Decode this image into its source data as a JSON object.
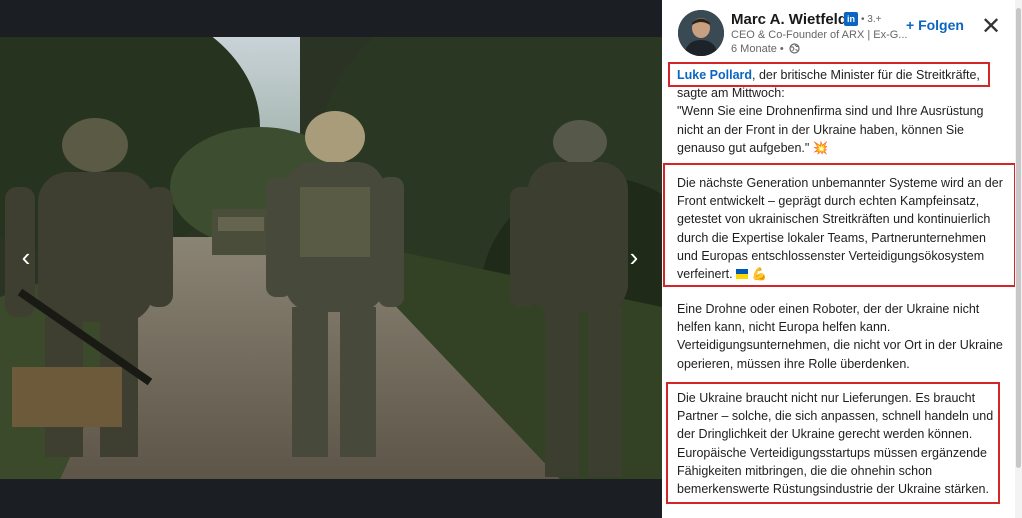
{
  "navigation": {
    "prev_label": "‹",
    "next_label": "›"
  },
  "author": {
    "name": "Marc A. Wietfeld",
    "badge": "in",
    "degree": "• 3.+",
    "headline": "CEO & Co-Founder of ARX | Ex-G...",
    "time": "6 Monate •",
    "visibility_icon": "globe-icon"
  },
  "actions": {
    "follow_label": "+ Folgen",
    "close_label": "✕"
  },
  "post": {
    "p1_mention": "Luke Pollard",
    "p1_line1_rest": ", der britische Minister für die Streitkräfte,",
    "p1_line2": "sagte am Mittwoch:",
    "p1_quote": "\"Wenn Sie eine Drohnenfirma sind und Ihre Ausrüstung nicht an der Front in der Ukraine haben, können Sie genauso gut aufgeben.\"",
    "p1_emoji": "💥",
    "p2": "Die nächste Generation unbemannter Systeme wird an der Front entwickelt – geprägt durch echten Kampfeinsatz, getestet von ukrainischen Streitkräften und kontinuierlich durch die Expertise lokaler Teams, Partnerunternehmen und Europas entschlossenster Verteidigungsökosystem verfeinert.",
    "p2_emoji_flag": "ukraine-flag-icon",
    "p2_emoji_arm": "💪",
    "p3": "Eine Drohne oder einen Roboter, der der Ukraine nicht helfen kann, nicht Europa helfen kann. Verteidigungsunternehmen, die nicht vor Ort in der Ukraine operieren, müssen ihre Rolle überdenken.",
    "p4": "Die Ukraine braucht nicht nur Lieferungen. Es braucht Partner – solche, die sich anpassen, schnell handeln und der Dringlichkeit der Ukraine gerecht werden können. Europäische Verteidigungsstartups müssen ergänzende Fähigkeiten mitbringen, die die ohnehin schon bemerkenswerte Rüstungsindustrie der Ukraine stärken."
  },
  "colors": {
    "link": "#0a66c2",
    "highlight": "#d42626",
    "flag_blue": "#0057b7",
    "flag_yellow": "#ffd700"
  }
}
